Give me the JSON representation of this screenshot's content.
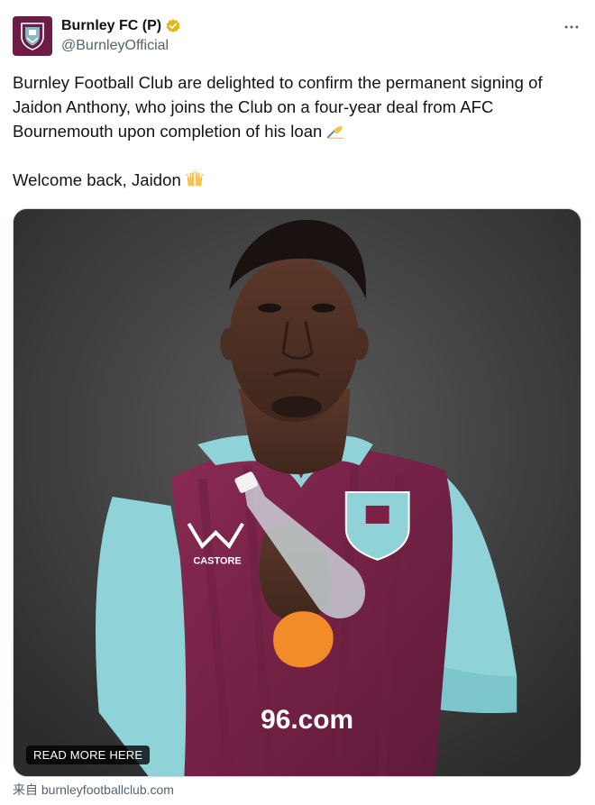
{
  "author": {
    "display_name": "Burnley FC (P)",
    "handle": "@BurnleyOfficial",
    "avatar_icon": "burnley-crest-icon",
    "verified_icon": "verified-gold-badge-icon",
    "avatar_color": "#6c1d45",
    "verified_color": "#e2b719"
  },
  "tweet": {
    "paragraph_1": "Burnley Football Club are delighted to confirm the permanent signing of Jaidon Anthony, who joins the Club on a four-year deal from AFC Bournemouth upon completion of his loan",
    "paragraph_1_emoji": "writing-hand-emoji",
    "paragraph_2": "Welcome back, Jaidon",
    "paragraph_2_emoji": "raising-hands-emoji"
  },
  "media": {
    "read_more_label": "READ MORE HERE",
    "shirt_sponsor": "96.com",
    "shirt_brand": "CASTORE",
    "shirt_colors": {
      "claret": "#7a2245",
      "sky_blue": "#8fd3d8"
    }
  },
  "card": {
    "source_label": "来自 burnleyfootballclub.com"
  },
  "more_icon": "ellipsis-horizontal-icon"
}
